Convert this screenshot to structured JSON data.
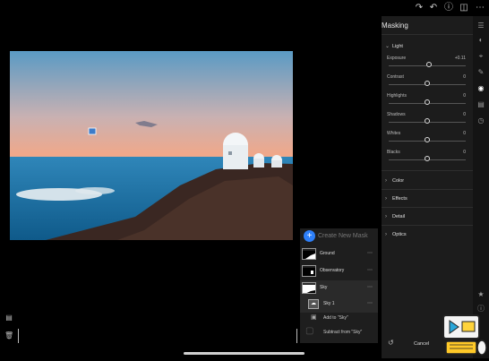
{
  "toolbar": {
    "icons": [
      "redo-icon",
      "undo-icon",
      "help-icon",
      "compare-icon",
      "more-icon"
    ]
  },
  "panel": {
    "title": "Masking",
    "light": {
      "label": "Light",
      "sliders": [
        {
          "name": "Exposure",
          "value": "+0.11",
          "level": 0.52
        },
        {
          "name": "Contrast",
          "value": "0",
          "level": 0.5
        },
        {
          "name": "Highlights",
          "value": "0",
          "level": 0.5
        },
        {
          "name": "Shadows",
          "value": "0",
          "level": 0.5
        },
        {
          "name": "Whites",
          "value": "0",
          "level": 0.5
        },
        {
          "name": "Blacks",
          "value": "0",
          "level": 0.5
        }
      ]
    },
    "sections": [
      "Color",
      "Effects",
      "Detail",
      "Optics"
    ]
  },
  "masks": {
    "create_label": "Create New Mask",
    "items": [
      {
        "label": "Ground"
      },
      {
        "label": "Observatory"
      },
      {
        "label": "Sky"
      }
    ],
    "sub_item": {
      "label": "Sky 1"
    },
    "add_label": "Add to \"Sky\"",
    "subtract_label": "Subtract from \"Sky\""
  },
  "bottom": {
    "cancel_label": "Cancel"
  }
}
